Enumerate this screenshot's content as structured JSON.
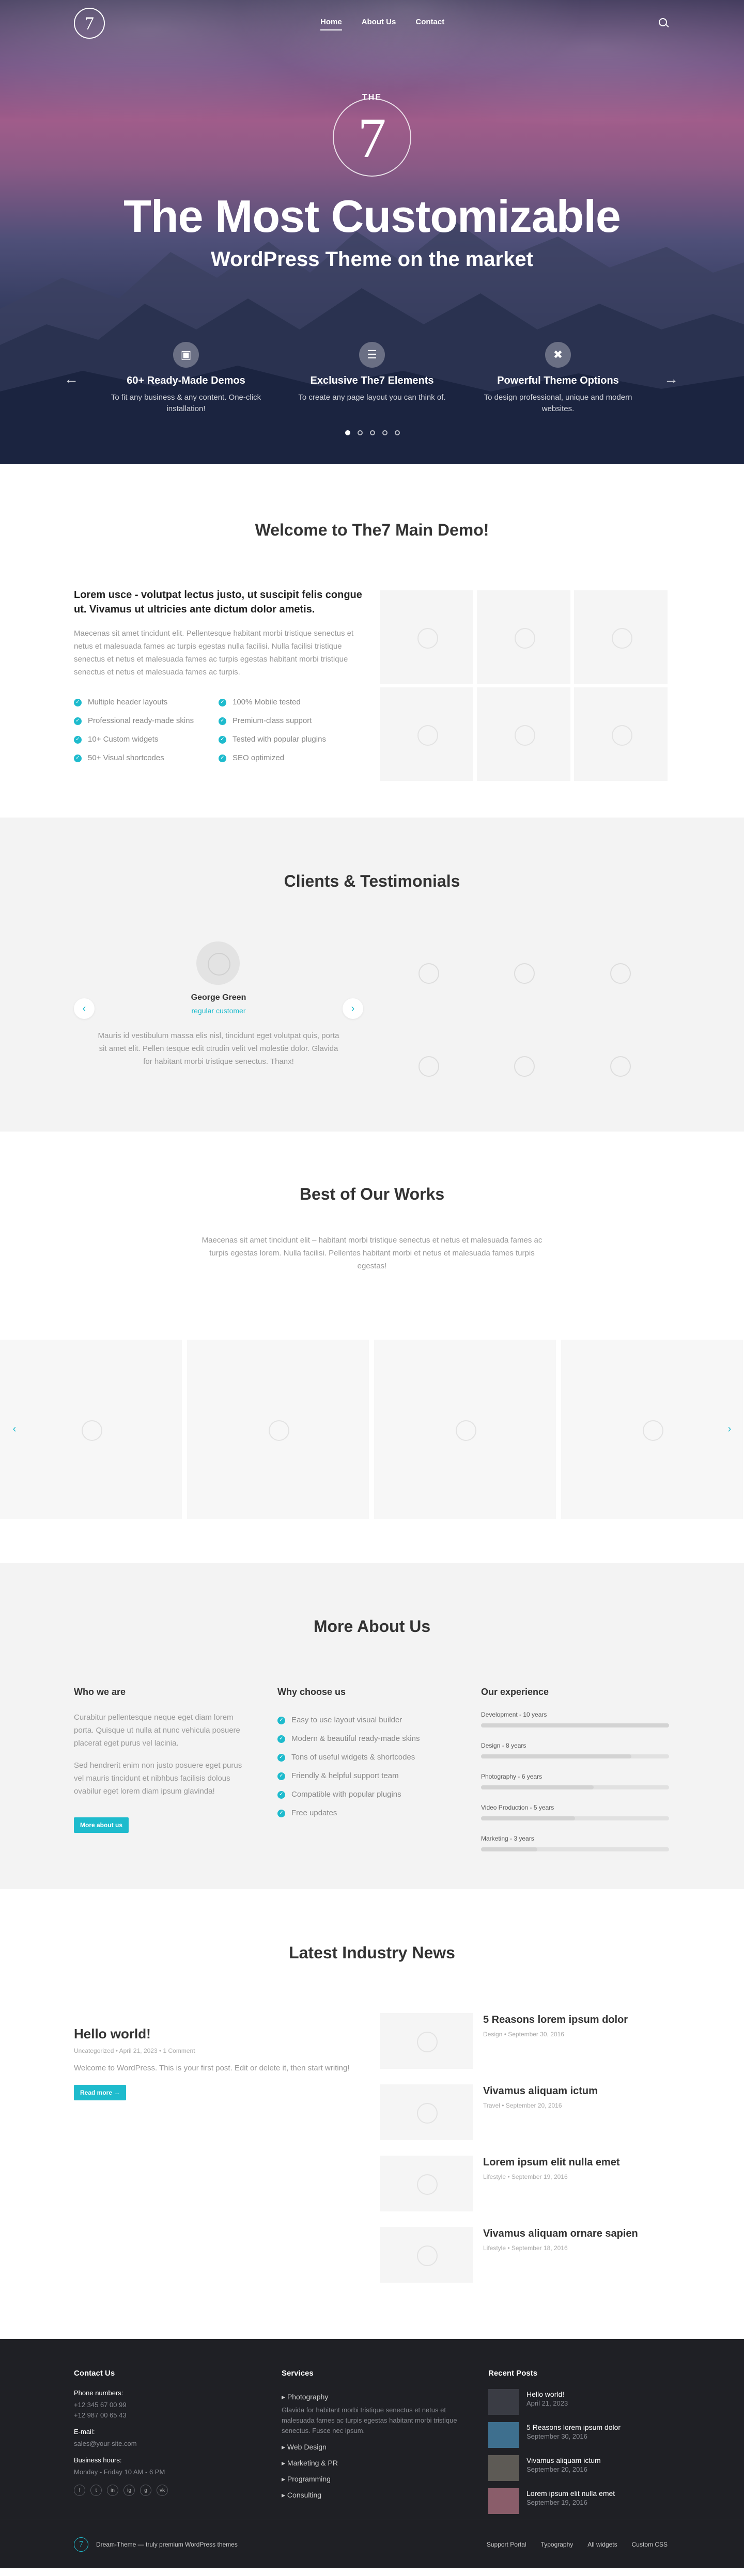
{
  "nav": {
    "logo": "7",
    "items": [
      "Home",
      "About Us",
      "Contact"
    ]
  },
  "hero": {
    "badge_top": "THE",
    "badge_num": "7",
    "title": "The Most Customizable",
    "subtitle": "WordPress Theme on the market",
    "features": [
      {
        "icon": "▣",
        "title": "60+ Ready-Made Demos",
        "text": "To fit any business & any content. One-click installation!"
      },
      {
        "icon": "☰",
        "title": "Exclusive The7 Elements",
        "text": "To create any page layout you can think of."
      },
      {
        "icon": "✖",
        "title": "Powerful Theme Options",
        "text": "To design professional, unique and modern websites."
      }
    ],
    "prev": "←",
    "next": "→"
  },
  "welcome": {
    "title": "Welcome to The7 Main Demo!",
    "lead": "Lorem usce - volutpat lectus justo, ut suscipit felis congue ut. Vivamus ut ultricies ante dictum dolor ametis.",
    "text": "Maecenas sit amet tincidunt elit. Pellentesque habitant morbi tristique senectus et netus et malesuada fames ac turpis egestas nulla facilisi. Nulla facilisi tristique senectus et netus et malesuada fames ac turpis egestas habitant morbi tristique senectus et netus et malesuada fames ac turpis.",
    "list_left": [
      "Multiple header layouts",
      "Professional ready-made skins",
      "10+ Custom widgets",
      "50+ Visual shortcodes"
    ],
    "list_right": [
      "100% Mobile tested",
      "Premium-class support",
      "Tested with popular plugins",
      "SEO optimized"
    ]
  },
  "clients": {
    "title": "Clients & Testimonials",
    "name": "George Green",
    "role": "regular customer",
    "quote": "Mauris id vestibulum massa elis nisl, tincidunt eget volutpat quis, porta sit amet elit. Pellen tesque edit ctrudin velit vel molestie dolor. Glavida for habitant morbi tristique senectus. Thanx!"
  },
  "works": {
    "title": "Best of Our Works",
    "text": "Maecenas sit amet tincidunt elit – habitant morbi tristique senectus et netus et malesuada fames ac turpis egestas lorem. Nulla facilisi. Pellentes habitant morbi et netus et malesuada fames turpis egestas!"
  },
  "more": {
    "title": "More About Us",
    "who_title": "Who we are",
    "who_p1": "Curabitur pellentesque neque eget diam lorem porta. Quisque ut nulla at nunc vehicula posuere placerat eget purus vel lacinia.",
    "who_p2": "Sed hendrerit enim non justo posuere eget purus vel mauris tincidunt et nibhbus facilisis dolous ovabilur eget lorem diam ipsum glavinda!",
    "who_btn": "More about us",
    "why_title": "Why choose us",
    "why_list": [
      "Easy to use layout visual builder",
      "Modern & beautiful ready-made skins",
      "Tons of useful widgets & shortcodes",
      "Friendly & helpful support team",
      "Compatible with popular plugins",
      "Free updates"
    ],
    "exp_title": "Our experience",
    "bars": [
      {
        "label": "Development - 10 years",
        "pct": 100
      },
      {
        "label": "Design - 8 years",
        "pct": 80
      },
      {
        "label": "Photography - 6 years",
        "pct": 60
      },
      {
        "label": "Video Production - 5 years",
        "pct": 50
      },
      {
        "label": "Marketing - 3 years",
        "pct": 30
      }
    ]
  },
  "news": {
    "title": "Latest Industry News",
    "featured": {
      "title": "Hello world!",
      "meta": "Uncategorized • April 21, 2023 • 1 Comment",
      "text": "Welcome to WordPress. This is your first post. Edit or delete it, then start writing!",
      "btn": "Read more →"
    },
    "posts": [
      {
        "title": "5 Reasons lorem ipsum dolor",
        "meta": "Design • September 30, 2016"
      },
      {
        "title": "Vivamus aliquam ictum",
        "meta": "Travel • September 20, 2016"
      },
      {
        "title": "Lorem ipsum elit nulla emet",
        "meta": "Lifestyle • September 19, 2016"
      },
      {
        "title": "Vivamus aliquam ornare sapien",
        "meta": "Lifestyle • September 18, 2016"
      }
    ]
  },
  "footer": {
    "contact_title": "Contact Us",
    "phone_label": "Phone numbers:",
    "phones": "+12 345 67 00 99\n+12 987 00 65 43",
    "email_label": "E-mail:",
    "email": "sales@your-site.com",
    "hours_label": "Business hours:",
    "hours": "Monday - Friday 10 AM - 6 PM",
    "services_title": "Services",
    "services_first": "Photography",
    "services_text": "Glavida for habitant morbi tristique senectus et netus et malesuada fames ac turpis egestas habitant morbi tristique senectus. Fusce nec ipsum.",
    "services": [
      "Web Design",
      "Marketing & PR",
      "Programming",
      "Consulting"
    ],
    "recent_title": "Recent Posts",
    "recent": [
      {
        "title": "Hello world!",
        "date": "April 21, 2023"
      },
      {
        "title": "5 Reasons lorem ipsum dolor",
        "date": "September 30, 2016"
      },
      {
        "title": "Vivamus aliquam ictum",
        "date": "September 20, 2016"
      },
      {
        "title": "Lorem ipsum elit nulla emet",
        "date": "September 19, 2016"
      }
    ],
    "social": [
      "f",
      "t",
      "in",
      "ig",
      "g",
      "vk"
    ],
    "copyright": "Dream-Theme — truly premium WordPress themes",
    "bottom_links": [
      "Support Portal",
      "Typography",
      "All widgets",
      "Custom CSS"
    ],
    "logo": "7"
  }
}
